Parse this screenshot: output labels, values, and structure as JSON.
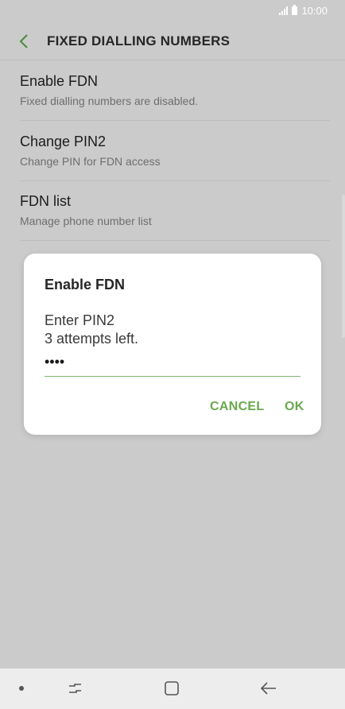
{
  "status_bar": {
    "time": "10:00"
  },
  "header": {
    "title": "FIXED DIALLING NUMBERS"
  },
  "list": [
    {
      "primary": "Enable FDN",
      "secondary": "Fixed dialling numbers are disabled."
    },
    {
      "primary": "Change PIN2",
      "secondary": "Change PIN for FDN access"
    },
    {
      "primary": "FDN list",
      "secondary": "Manage phone number list"
    }
  ],
  "dialog": {
    "title": "Enable FDN",
    "prompt": "Enter PIN2",
    "attempts": "3 attempts left.",
    "pin_value": "••••",
    "cancel_label": "CANCEL",
    "ok_label": "OK"
  },
  "colors": {
    "accent": "#6aa84f",
    "scrim": "#cbcbcb",
    "dialog_bg": "#ffffff"
  },
  "icons": {
    "back": "chevron-left-icon",
    "recent": "recent-apps-icon",
    "home": "home-icon",
    "nav_back": "back-arrow-icon"
  }
}
